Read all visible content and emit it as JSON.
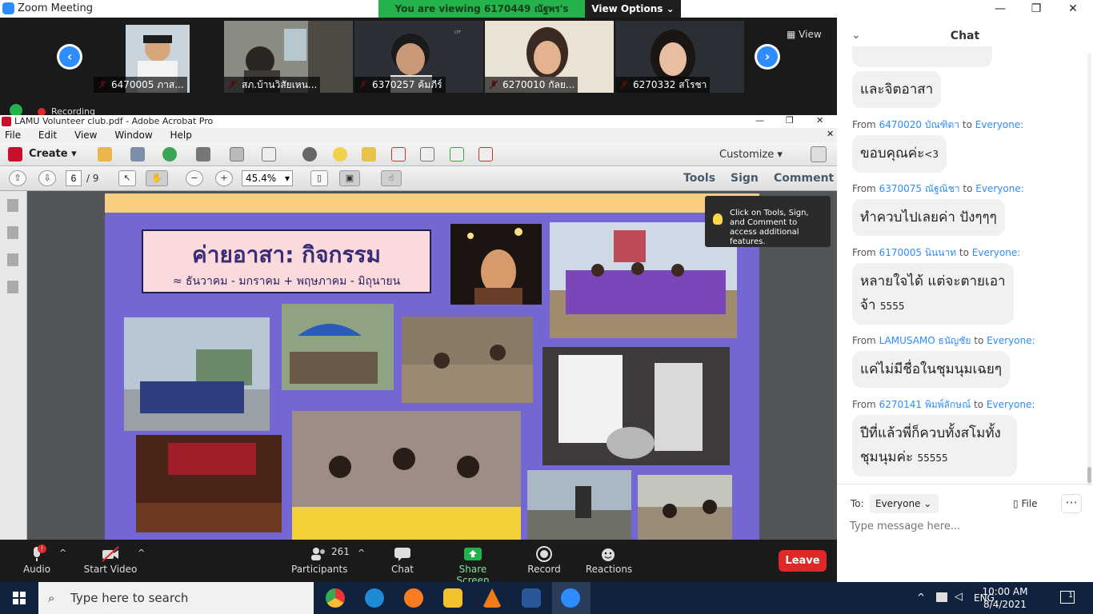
{
  "zoom": {
    "window_title": "Zoom Meeting",
    "viewing_banner": "You are viewing 6170449 ณัฐพร's screen",
    "view_options": "View Options",
    "view_label": "View",
    "recording": "Recording",
    "participants": [
      {
        "name": "6470005 ภาส..."
      },
      {
        "name": "สภ.บ้านวิสัยเหน..."
      },
      {
        "name": "6370257 ค้มภีร์"
      },
      {
        "name": "6270010 กัลย..."
      },
      {
        "name": "6270332 สโรชา"
      }
    ],
    "toolbar": {
      "audio": "Audio",
      "start_video": "Start Video",
      "participants_label": "Participants",
      "participants_count": "261",
      "chat": "Chat",
      "share_screen": "Share Screen",
      "record": "Record",
      "reactions": "Reactions",
      "leave": "Leave",
      "audio_badge": "!"
    }
  },
  "acrobat": {
    "window_title": "LAMU Volunteer club.pdf - Adobe Acrobat Pro",
    "menu": [
      "File",
      "Edit",
      "View",
      "Window",
      "Help"
    ],
    "create": "Create",
    "customize": "Customize",
    "page_current": "6",
    "page_total": "/ 9",
    "zoom": "45.4%",
    "tools": "Tools",
    "sign": "Sign",
    "comment": "Comment",
    "tooltip": "Click on Tools, Sign, and Comment to access additional features."
  },
  "slide": {
    "title": "ค่ายอาสา: กิจกรรม",
    "subtitle": "≈ ธันวาคม - มกราคม + พฤษภาคม - มิถุนายน"
  },
  "chat": {
    "title": "Chat",
    "messages": [
      {
        "from": "",
        "to": "",
        "text": "และจิตอาสา",
        "extra": ""
      },
      {
        "from": "6470020 บัณฑิตา",
        "to": "Everyone:",
        "text": "ขอบคุณค่ะ",
        "extra": "<3"
      },
      {
        "from": "6370075 ณัฐณิชา",
        "to": "Everyone:",
        "text": "ทำควบไปเลยค่า ปังๆๆๆ",
        "extra": ""
      },
      {
        "from": "6170005 นินนาท",
        "to": "Everyone:",
        "text": "หลายใจได้ แต่จะตายเอาจ้า",
        "extra": "5555"
      },
      {
        "from": "LAMUSAMO ธนัญชัย",
        "to": "Everyone:",
        "text": "แค่ไม่มีชื่อในชุมนุมเฉยๆ",
        "extra": ""
      },
      {
        "from": "6270141 พิมพ์ลักษณ์",
        "to": "Everyone:",
        "text": "ปีที่แล้วพี่ก็ควบทั้งสโมทั้งชุมนุมค่ะ",
        "extra": "55555"
      }
    ],
    "from_word": "From",
    "to_word": "to",
    "to_label": "To:",
    "to_value": "Everyone",
    "file": "File",
    "more": "···",
    "input_placeholder": "Type message here..."
  },
  "taskbar": {
    "search_placeholder": "Type here to search",
    "lang": "ENG",
    "time": "10:00 AM",
    "date": "8/4/2021",
    "notification_count": "1"
  }
}
